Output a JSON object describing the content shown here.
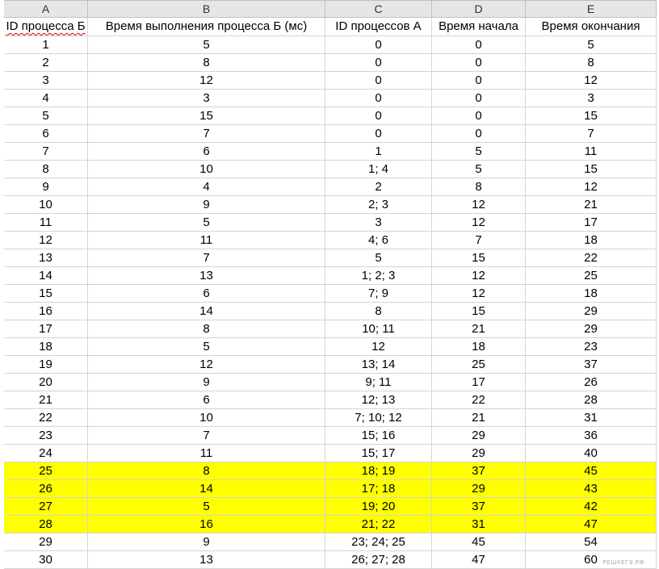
{
  "columns": [
    "A",
    "B",
    "C",
    "D",
    "E"
  ],
  "header": {
    "a": "ID процесса Б",
    "b": "Время выполнения процесса Б (мс)",
    "c": "ID процессов А",
    "d": "Время начала",
    "e": "Время окончания"
  },
  "rows": [
    {
      "a": "1",
      "b": "5",
      "c": "0",
      "d": "0",
      "e": "5"
    },
    {
      "a": "2",
      "b": "8",
      "c": "0",
      "d": "0",
      "e": "8"
    },
    {
      "a": "3",
      "b": "12",
      "c": "0",
      "d": "0",
      "e": "12"
    },
    {
      "a": "4",
      "b": "3",
      "c": "0",
      "d": "0",
      "e": "3"
    },
    {
      "a": "5",
      "b": "15",
      "c": "0",
      "d": "0",
      "e": "15"
    },
    {
      "a": "6",
      "b": "7",
      "c": "0",
      "d": "0",
      "e": "7"
    },
    {
      "a": "7",
      "b": "6",
      "c": "1",
      "d": "5",
      "e": "11"
    },
    {
      "a": "8",
      "b": "10",
      "c": "1; 4",
      "d": "5",
      "e": "15"
    },
    {
      "a": "9",
      "b": "4",
      "c": "2",
      "d": "8",
      "e": "12"
    },
    {
      "a": "10",
      "b": "9",
      "c": "2; 3",
      "d": "12",
      "e": "21"
    },
    {
      "a": "11",
      "b": "5",
      "c": "3",
      "d": "12",
      "e": "17"
    },
    {
      "a": "12",
      "b": "11",
      "c": "4; 6",
      "d": "7",
      "e": "18"
    },
    {
      "a": "13",
      "b": "7",
      "c": "5",
      "d": "15",
      "e": "22"
    },
    {
      "a": "14",
      "b": "13",
      "c": "1; 2; 3",
      "d": "12",
      "e": "25"
    },
    {
      "a": "15",
      "b": "6",
      "c": "7; 9",
      "d": "12",
      "e": "18"
    },
    {
      "a": "16",
      "b": "14",
      "c": "8",
      "d": "15",
      "e": "29"
    },
    {
      "a": "17",
      "b": "8",
      "c": "10; 11",
      "d": "21",
      "e": "29"
    },
    {
      "a": "18",
      "b": "5",
      "c": "12",
      "d": "18",
      "e": "23"
    },
    {
      "a": "19",
      "b": "12",
      "c": "13; 14",
      "d": "25",
      "e": "37"
    },
    {
      "a": "20",
      "b": "9",
      "c": "9; 11",
      "d": "17",
      "e": "26"
    },
    {
      "a": "21",
      "b": "6",
      "c": "12; 13",
      "d": "22",
      "e": "28"
    },
    {
      "a": "22",
      "b": "10",
      "c": "7; 10; 12",
      "d": "21",
      "e": "31"
    },
    {
      "a": "23",
      "b": "7",
      "c": "15; 16",
      "d": "29",
      "e": "36"
    },
    {
      "a": "24",
      "b": "11",
      "c": "15; 17",
      "d": "29",
      "e": "40"
    },
    {
      "a": "25",
      "b": "8",
      "c": "18; 19",
      "d": "37",
      "e": "45"
    },
    {
      "a": "26",
      "b": "14",
      "c": "17; 18",
      "d": "29",
      "e": "43"
    },
    {
      "a": "27",
      "b": "5",
      "c": "19; 20",
      "d": "37",
      "e": "42"
    },
    {
      "a": "28",
      "b": "16",
      "c": "21; 22",
      "d": "31",
      "e": "47"
    },
    {
      "a": "29",
      "b": "9",
      "c": "23; 24; 25",
      "d": "45",
      "e": "54"
    },
    {
      "a": "30",
      "b": "13",
      "c": "26; 27; 28",
      "d": "47",
      "e": "60"
    }
  ],
  "highlighted_rows": [
    "25",
    "26",
    "27",
    "28"
  ],
  "highlight_color": "#ffff00",
  "watermark": "РЕШУЕГЭ.РФ"
}
